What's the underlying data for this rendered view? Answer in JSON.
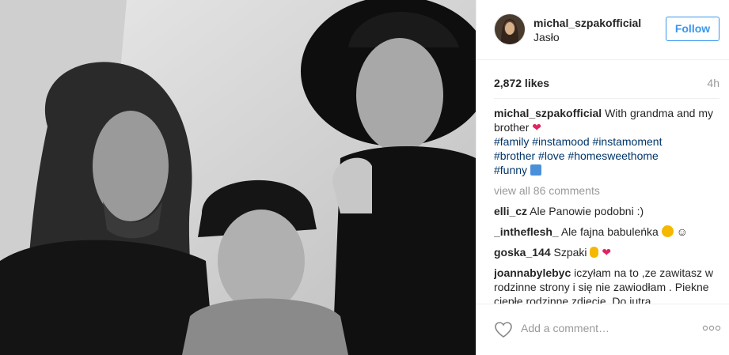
{
  "post": {
    "username": "michal_szpakofficial",
    "location": "Jasło",
    "follow_label": "Follow",
    "likes": "2,872 likes",
    "time": "4h"
  },
  "caption": {
    "username": "michal_szpakofficial",
    "text": "With grandma and my brother",
    "emoji": "heart",
    "hashtags": [
      "#family",
      "#instamood",
      "#instamoment",
      "#brother",
      "#love",
      "#homesweethome",
      "#funny"
    ],
    "trailing_emoji": "ok-hand"
  },
  "view_all_comments": "view all 86 comments",
  "comments": [
    {
      "user": "elli_cz",
      "text": "Ale Panowie podobni :)"
    },
    {
      "user": "_intheflesh_",
      "text": "Ale fajna babuleńka",
      "emoji": "smiley ☺"
    },
    {
      "user": "goska_144",
      "text": "Szpaki",
      "emoji": "ok-hand heart"
    },
    {
      "user": "joannabylebyc",
      "text": "iczyłam na to ,ze zawitasz w rodzinne strony i się nie zawiodłam . Piekne ciepłe rodzinne zdiecie. Do jutra."
    }
  ],
  "footer": {
    "add_comment_placeholder": "Add a comment…",
    "more_label": "ooo"
  },
  "colors": {
    "accent": "#3897f0",
    "hashtag": "#003569",
    "muted": "#999999",
    "heart": "#e0245e"
  },
  "icons": [
    "like-heart-icon",
    "more-options-icon",
    "heart-emoji-icon",
    "ok-hand-emoji-icon",
    "smiley-emoji-icon"
  ]
}
